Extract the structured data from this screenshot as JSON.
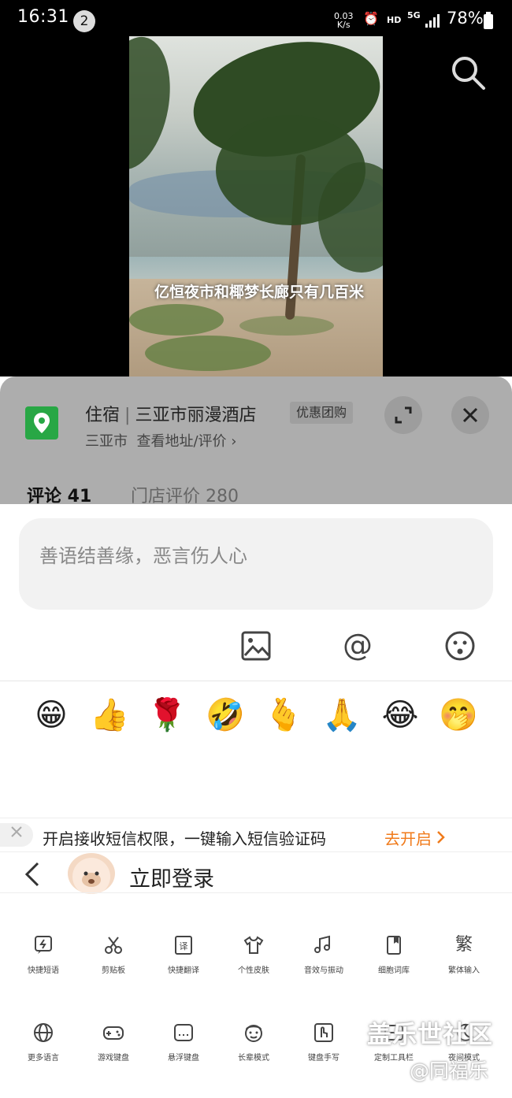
{
  "status_bar": {
    "time": "16:31",
    "notification_count": "2",
    "net_speed": "0.03",
    "net_unit": "K/s",
    "hd": "HD",
    "signal": "5G",
    "battery": "78%"
  },
  "video": {
    "caption": "亿恒夜市和椰梦长廊只有几百米"
  },
  "poi": {
    "category": "住宿",
    "name": "三亚市丽漫酒店",
    "promo": "优惠团购",
    "city": "三亚市",
    "link": "查看地址/评价 ›"
  },
  "tabs": {
    "comments": "评论 41",
    "store_reviews": "门店评价 280"
  },
  "comment": {
    "placeholder": "善语结善缘，恶言伤人心"
  },
  "emojis": [
    "😁",
    "👍",
    "🌹",
    "🤣",
    "🫰",
    "🙏",
    "😂",
    "🤭"
  ],
  "sms": {
    "text": "开启接收短信权限，一键输入短信验证码",
    "action": "去开启"
  },
  "keyboard": {
    "login": "立即登录",
    "row1": [
      {
        "label": "快捷短语",
        "icon": "quick-phrase-icon"
      },
      {
        "label": "剪贴板",
        "icon": "scissors-icon"
      },
      {
        "label": "快捷翻译",
        "icon": "translate-icon"
      },
      {
        "label": "个性皮肤",
        "icon": "tshirt-icon"
      },
      {
        "label": "音效与振动",
        "icon": "music-icon"
      },
      {
        "label": "细胞词库",
        "icon": "book-icon"
      },
      {
        "label": "繁体输入",
        "icon": "traditional-char-icon",
        "glyph": "繁"
      }
    ],
    "row2": [
      {
        "label": "更多语言",
        "icon": "globe-icon"
      },
      {
        "label": "游戏键盘",
        "icon": "gamepad-icon"
      },
      {
        "label": "悬浮键盘",
        "icon": "floating-keyboard-icon"
      },
      {
        "label": "长辈模式",
        "icon": "elder-face-icon"
      },
      {
        "label": "键盘手写",
        "icon": "handwriting-icon"
      },
      {
        "label": "定制工具栏",
        "icon": "toolbar-icon"
      },
      {
        "label": "夜间模式",
        "icon": "moon-icon"
      }
    ]
  },
  "watermark": {
    "line1": "盖乐世社区",
    "line2": "@同福乐"
  }
}
